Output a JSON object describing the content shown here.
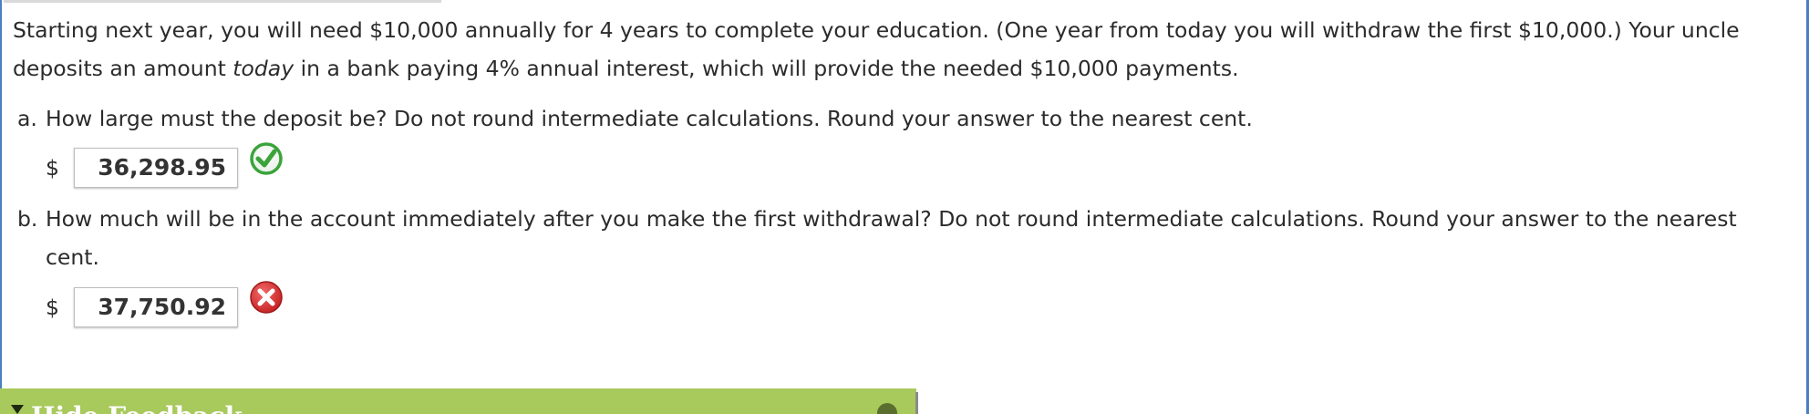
{
  "question": {
    "intro_before_italic": "Starting next year, you will need $10,000 annually for 4 years to complete your education. (One year from today you will withdraw the first $10,000.) Your uncle deposits an amount ",
    "intro_italic": "today",
    "intro_after_italic": " in a bank paying 4% annual interest, which will provide the needed $10,000 payments."
  },
  "part_a": {
    "letter": "a.",
    "prompt": "How large must the deposit be? Do not round intermediate calculations. Round your answer to the nearest cent.",
    "currency": "$",
    "answer": "36,298.95",
    "status": "correct"
  },
  "part_b": {
    "letter": "b.",
    "prompt_line1": "How much will be in the account immediately after you make the first withdrawal? Do not round intermediate calculations. Round your answer to the nearest",
    "prompt_line2": "cent.",
    "currency": "$",
    "answer": "37,750.92",
    "status": "incorrect"
  },
  "feedback": {
    "label": "Hide Feedback"
  },
  "icons": {
    "correct": "check-circle-icon",
    "incorrect": "x-circle-icon",
    "toggle": "caret-down-icon"
  },
  "colors": {
    "frame_border": "#4a7fc1",
    "feedback_bar": "#a8c95c",
    "correct_green": "#3aa33a",
    "incorrect_red": "#d62a2a"
  }
}
